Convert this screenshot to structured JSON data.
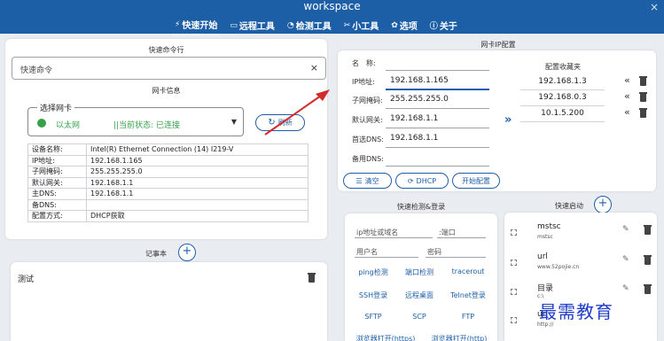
{
  "window": {
    "title": "workspace",
    "close_glyph": "×"
  },
  "nav": [
    {
      "label": "快速开始",
      "icon": "lightning-icon",
      "glyph": "⚡"
    },
    {
      "label": "远程工具",
      "icon": "monitor-icon",
      "glyph": "▭"
    },
    {
      "label": "检测工具",
      "icon": "wifi-icon",
      "glyph": "◔"
    },
    {
      "label": "小工具",
      "icon": "tools-icon",
      "glyph": "✂"
    },
    {
      "label": "选项",
      "icon": "gear-icon",
      "glyph": "✿"
    },
    {
      "label": "关于",
      "icon": "info-icon",
      "glyph": "ⓘ"
    }
  ],
  "quick_command": {
    "section_title": "快速命令行",
    "placeholder": "快速命令",
    "clear_glyph": "×"
  },
  "nic": {
    "section_title": "网卡信息",
    "select_label": "选择网卡",
    "selected_name": "以太网",
    "status_text": "||当前状态: 已连接",
    "refresh_label": "刷新",
    "rows": [
      {
        "key": "设备名称:",
        "value": "Intel(R) Ethernet Connection (14) I219-V"
      },
      {
        "key": "IP地址:",
        "value": "192.168.1.165"
      },
      {
        "key": "子网掩码:",
        "value": "255.255.255.0"
      },
      {
        "key": "默认网关:",
        "value": "192.168.1.1"
      },
      {
        "key": "主DNS:",
        "value": "192.168.1.1"
      },
      {
        "key": "备DNS:",
        "value": ""
      },
      {
        "key": "配置方式:",
        "value": "DHCP获取"
      }
    ]
  },
  "notes": {
    "section_title": "记事本",
    "content": "测试",
    "add_glyph": "+"
  },
  "ip_config": {
    "section_title": "网卡IP配置",
    "fields": [
      {
        "label": "名　称:",
        "value": ""
      },
      {
        "label": "IP地址:",
        "value": "192.168.1.165"
      },
      {
        "label": "子网掩码:",
        "value": "255.255.255.0"
      },
      {
        "label": "默认网关:",
        "value": "192.168.1.1"
      },
      {
        "label": "首选DNS:",
        "value": "192.168.1.1"
      },
      {
        "label": "备用DNS:",
        "value": ""
      }
    ],
    "buttons": {
      "clear": "清空",
      "dhcp": "DHCP",
      "apply": "开始配置"
    }
  },
  "favorites": {
    "title": "配置收藏夹",
    "items": [
      "192.168.1.3",
      "192.168.0.3",
      "10.1.5.200"
    ],
    "arrow_glyph": "«",
    "transfer_glyph": "»"
  },
  "quick_check": {
    "title": "快速检测&登录",
    "host_placeholder": "ip地址或域名",
    "port_placeholder": ":端口",
    "user_placeholder": "用户名",
    "password_placeholder": "密码",
    "buttons": [
      "ping检测",
      "端口检测",
      "tracerout",
      "SSH登录",
      "远程桌面",
      "Telnet登录",
      "SFTP",
      "SCP",
      "FTP",
      "浏览器打开(https)",
      "浏览器打开(http)"
    ]
  },
  "quick_launch": {
    "title": "快速启动",
    "add_glyph": "+",
    "items": [
      {
        "name": "mstsc",
        "sub": "mstsc"
      },
      {
        "name": "url",
        "sub": "www.52pojie.cn"
      },
      {
        "name": "目录",
        "sub": "c:\\"
      },
      {
        "name": "url",
        "sub": "http://"
      }
    ]
  },
  "watermark": "最需教育"
}
